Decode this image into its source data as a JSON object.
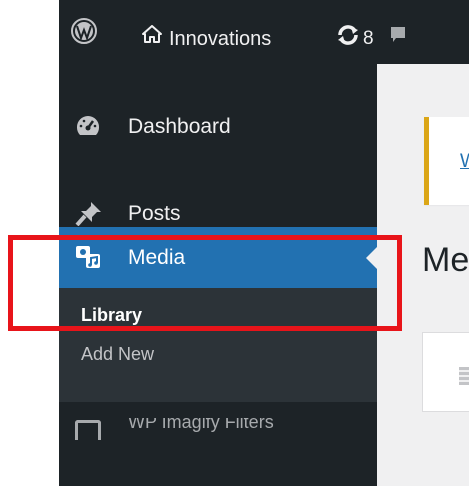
{
  "adminbar": {
    "site_name": "Innovations",
    "updates_count": "8",
    "icons": [
      "wordpress-logo-icon",
      "home-icon",
      "updates-icon",
      "comment-icon"
    ]
  },
  "sidebar": {
    "items": [
      {
        "label": "Dashboard",
        "icon": "dashboard-icon"
      },
      {
        "label": "Posts",
        "icon": "pin-icon"
      },
      {
        "label": "Media",
        "icon": "media-icon",
        "active": true
      }
    ],
    "submenu": [
      {
        "label": "Library",
        "current": true
      },
      {
        "label": "Add New"
      }
    ],
    "next_item_label": "WP Imagify Filters"
  },
  "main": {
    "notice_link": "W",
    "page_title": "Me"
  },
  "colors": {
    "admin_dark": "#1d2327",
    "active_blue": "#2271b1",
    "submenu_bg": "#2c3338",
    "notice_border": "#dba617",
    "highlight_red": "#e8141a"
  }
}
